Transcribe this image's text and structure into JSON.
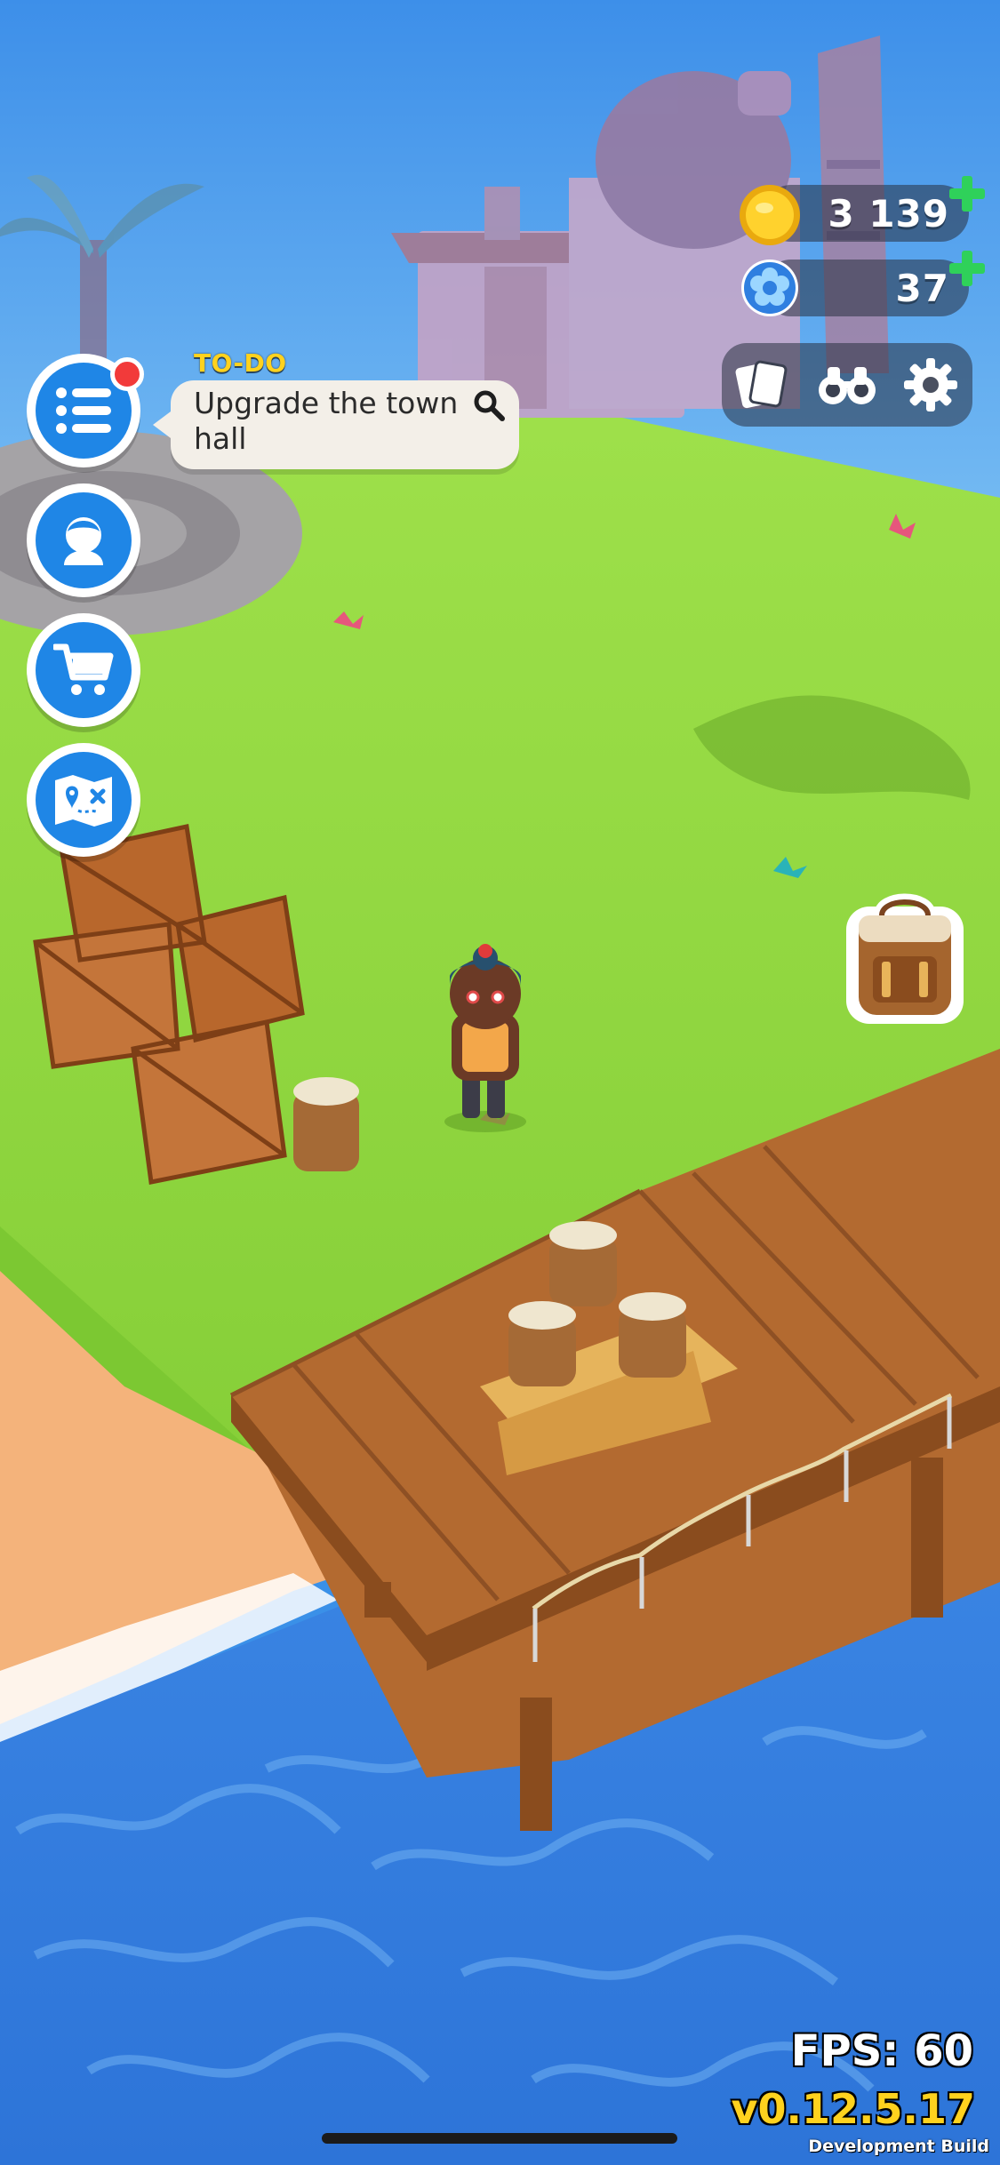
{
  "hud": {
    "coins": "3 139",
    "flowers": "37",
    "coin_icon": "gold-coin-icon",
    "flower_icon": "blue-flower-icon",
    "tools": [
      "cards-icon",
      "binoculars-icon",
      "gear-icon"
    ]
  },
  "menu": {
    "buttons": [
      "todo-list-icon",
      "avatar-icon",
      "cart-icon",
      "map-icon"
    ],
    "has_notification": true
  },
  "todo": {
    "label": "TO-DO",
    "text": "Upgrade the town hall"
  },
  "backpack": {
    "icon": "backpack-icon"
  },
  "debug": {
    "fps": "FPS: 60",
    "version": "v0.12.5.17",
    "build": "Development Build"
  },
  "colors": {
    "accent_blue": "#1f86e6",
    "grass": "#8fd63c",
    "water": "#2f7fe0",
    "wood": "#b36a30",
    "todo_label": "#ffd21e",
    "plus_green": "#2fd15a"
  }
}
